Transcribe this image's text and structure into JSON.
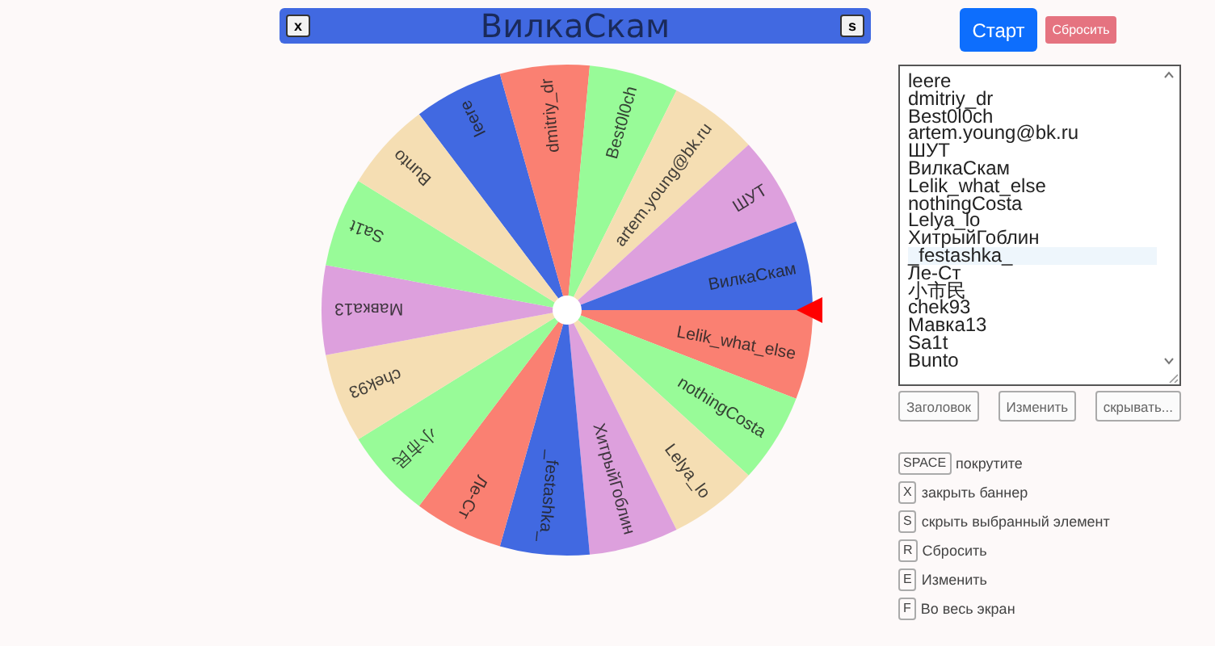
{
  "banner": {
    "close_key": "x",
    "title": "ВилкаСкам",
    "hide_key": "s"
  },
  "actions": {
    "start": "Старт",
    "reset": "Сбросить"
  },
  "wheel": {
    "segments": [
      {
        "name": "leere",
        "color": "#4169e1"
      },
      {
        "name": "dmitriy_dr",
        "color": "#fa8072"
      },
      {
        "name": "Best0l0ch",
        "color": "#98fb98"
      },
      {
        "name": "artem.young@bk.ru",
        "color": "#f5deb3"
      },
      {
        "name": "ШУТ",
        "color": "#dda0dd"
      },
      {
        "name": "ВилкаСкам",
        "color": "#4169e1"
      },
      {
        "name": "Lelik_what_else",
        "color": "#fa8072"
      },
      {
        "name": "nothingCosta",
        "color": "#98fb98"
      },
      {
        "name": "Lelya_lo",
        "color": "#f5deb3"
      },
      {
        "name": "ХитрыйГоблин",
        "color": "#dda0dd"
      },
      {
        "name": "_festashka_",
        "color": "#4169e1"
      },
      {
        "name": "Ле-Ст",
        "color": "#fa8072"
      },
      {
        "name": "小市民",
        "color": "#98fb98"
      },
      {
        "name": "chek93",
        "color": "#f5deb3"
      },
      {
        "name": "Мавка13",
        "color": "#dda0dd"
      },
      {
        "name": "Sa1t",
        "color": "#98fb98"
      },
      {
        "name": "Bunto",
        "color": "#f5deb3"
      }
    ]
  },
  "entries": [
    {
      "text": "leere",
      "selected": false
    },
    {
      "text": "dmitriy_dr",
      "selected": false
    },
    {
      "text": "Best0l0ch",
      "selected": false
    },
    {
      "text": "artem.young@bk.ru",
      "selected": false
    },
    {
      "text": "ШУТ",
      "selected": false
    },
    {
      "text": "ВилкаСкам",
      "selected": false
    },
    {
      "text": "Lelik_what_else",
      "selected": false
    },
    {
      "text": "nothingCosta",
      "selected": false
    },
    {
      "text": "Lelya_lo",
      "selected": false
    },
    {
      "text": "ХитрыйГоблин",
      "selected": false
    },
    {
      "text": "_festashka_",
      "selected": true
    },
    {
      "text": "Ле-Ст",
      "selected": false
    },
    {
      "text": "小市民",
      "selected": false
    },
    {
      "text": "chek93",
      "selected": false
    },
    {
      "text": "Мавка13",
      "selected": false
    },
    {
      "text": "Sa1t",
      "selected": false
    },
    {
      "text": "Bunto",
      "selected": false
    }
  ],
  "editor_buttons": [
    "Заголовок",
    "Изменить",
    "скрывать..."
  ],
  "shortcuts": [
    {
      "key": "SPACE",
      "label": "покрутите"
    },
    {
      "key": "X",
      "label": "закрыть баннер"
    },
    {
      "key": "S",
      "label": "скрыть выбранный элемент"
    },
    {
      "key": "R",
      "label": "Сбросить"
    },
    {
      "key": "E",
      "label": "Изменить"
    },
    {
      "key": "F",
      "label": "Во весь экран"
    }
  ]
}
